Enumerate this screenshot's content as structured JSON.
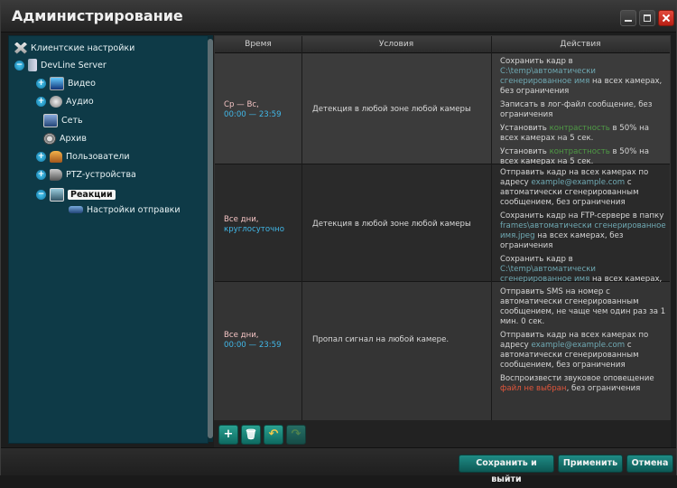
{
  "window": {
    "title": "Администрирование"
  },
  "tree": {
    "items": [
      {
        "label": "Клиентские настройки"
      },
      {
        "label": "DevLine Server"
      },
      {
        "label": "Видео"
      },
      {
        "label": "Аудио"
      },
      {
        "label": "Сеть"
      },
      {
        "label": "Архив"
      },
      {
        "label": "Пользователи"
      },
      {
        "label": "PTZ-устройства"
      },
      {
        "label": "Реакции"
      },
      {
        "label": "Настройки отправки"
      }
    ]
  },
  "grid": {
    "columns": [
      "Время",
      "Условия",
      "Действия"
    ],
    "rows": [
      {
        "time_label": "Ср — Вс,",
        "time_range": "00:00 — 23:59",
        "condition": "Детекция в любой зоне любой камеры",
        "actions": [
          {
            "a": "Сохранить кадр в ",
            "b": "C:\\temp\\автоматически сгенерированное имя",
            "c": " на всех камерах, без ограничения"
          },
          {
            "a": "Записать в лог-файл сообщение, без ограничения"
          },
          {
            "a": "Установить ",
            "b": "контрастность",
            "c": " в 50% на всех камерах на 5 сек."
          },
          {
            "a": "Установить ",
            "b": "контрастность",
            "c": " в 50% на всех камерах на 5 сек."
          }
        ]
      },
      {
        "time_label": "Все дни,",
        "time_range": "круглосуточно",
        "condition": "Детекция в любой зоне любой камеры",
        "actions": [
          {
            "a": "Отправить кадр на всех камерах по адресу ",
            "b": "example@example.com",
            "c": " с автоматически сгенерированным сообщением, без ограничения"
          },
          {
            "a": "Сохранить кадр на FTP-сервере в папку ",
            "b": "frames\\автоматически сгенерированное имя.jpeg",
            "c": " на всех камерах, без ограничения"
          },
          {
            "a": "Сохранить кадр в ",
            "b": "C:\\temp\\автоматически сгенерированное имя",
            "c": " на всех камерах, без ограничения"
          }
        ]
      },
      {
        "time_label": "Все дни,",
        "time_range": "00:00 — 23:59",
        "condition": "Пропал сигнал на любой камере.",
        "actions": [
          {
            "a": "Отправить SMS на номер ",
            "b": "",
            "c": " с автоматически сгенерированным сообщением, не чаще чем один раз за 1 мин. 0 сек."
          },
          {
            "a": "Отправить кадр на всех камерах по адресу ",
            "b": "example@example.com",
            "c": " с автоматически сгенерированным сообщением, без ограничения"
          },
          {
            "a": "Воспроизвести звуковое оповещение ",
            "r": "файл не выбран",
            "c": ", без ограничения"
          }
        ]
      }
    ]
  },
  "toolbar": {
    "add": "+",
    "delete": "🗑",
    "undo": "↶",
    "redo": "↷"
  },
  "buttons": {
    "save_exit": "Сохранить и выйти",
    "apply": "Применить",
    "cancel": "Отмена"
  },
  "colors": {
    "tree_bg": "#0e3a47",
    "accent": "#1f8b85",
    "time": "#41b6e6",
    "close": "#e34a3c"
  }
}
